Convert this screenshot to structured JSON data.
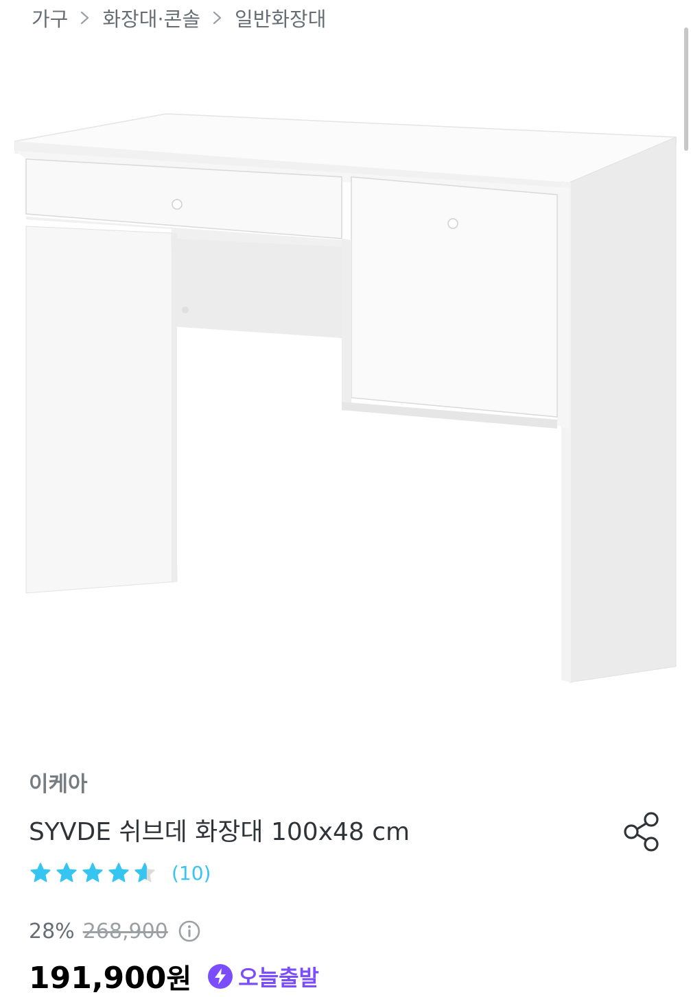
{
  "breadcrumb": [
    "가구",
    "화장대·콘솔",
    "일반화장대"
  ],
  "product": {
    "brand": "이케아",
    "title": "SYVDE 쉬브데 화장대 100x48 cm",
    "rating": 4.5,
    "review_count": "(10)",
    "discount_rate": "28%",
    "original_price": "268,900",
    "sale_price": "191,900",
    "currency": "원",
    "delivery_badge": "오늘출발"
  },
  "colors": {
    "accent_blue": "#35c5f0",
    "badge_purple": "#7a4dff",
    "text_primary": "#2f3438",
    "text_secondary": "#656e75"
  },
  "icons": {
    "breadcrumb_separator": "chevron-right-icon",
    "share": "share-icon",
    "rating": "star-icon",
    "price_info": "info-icon",
    "delivery": "lightning-bolt-icon"
  }
}
